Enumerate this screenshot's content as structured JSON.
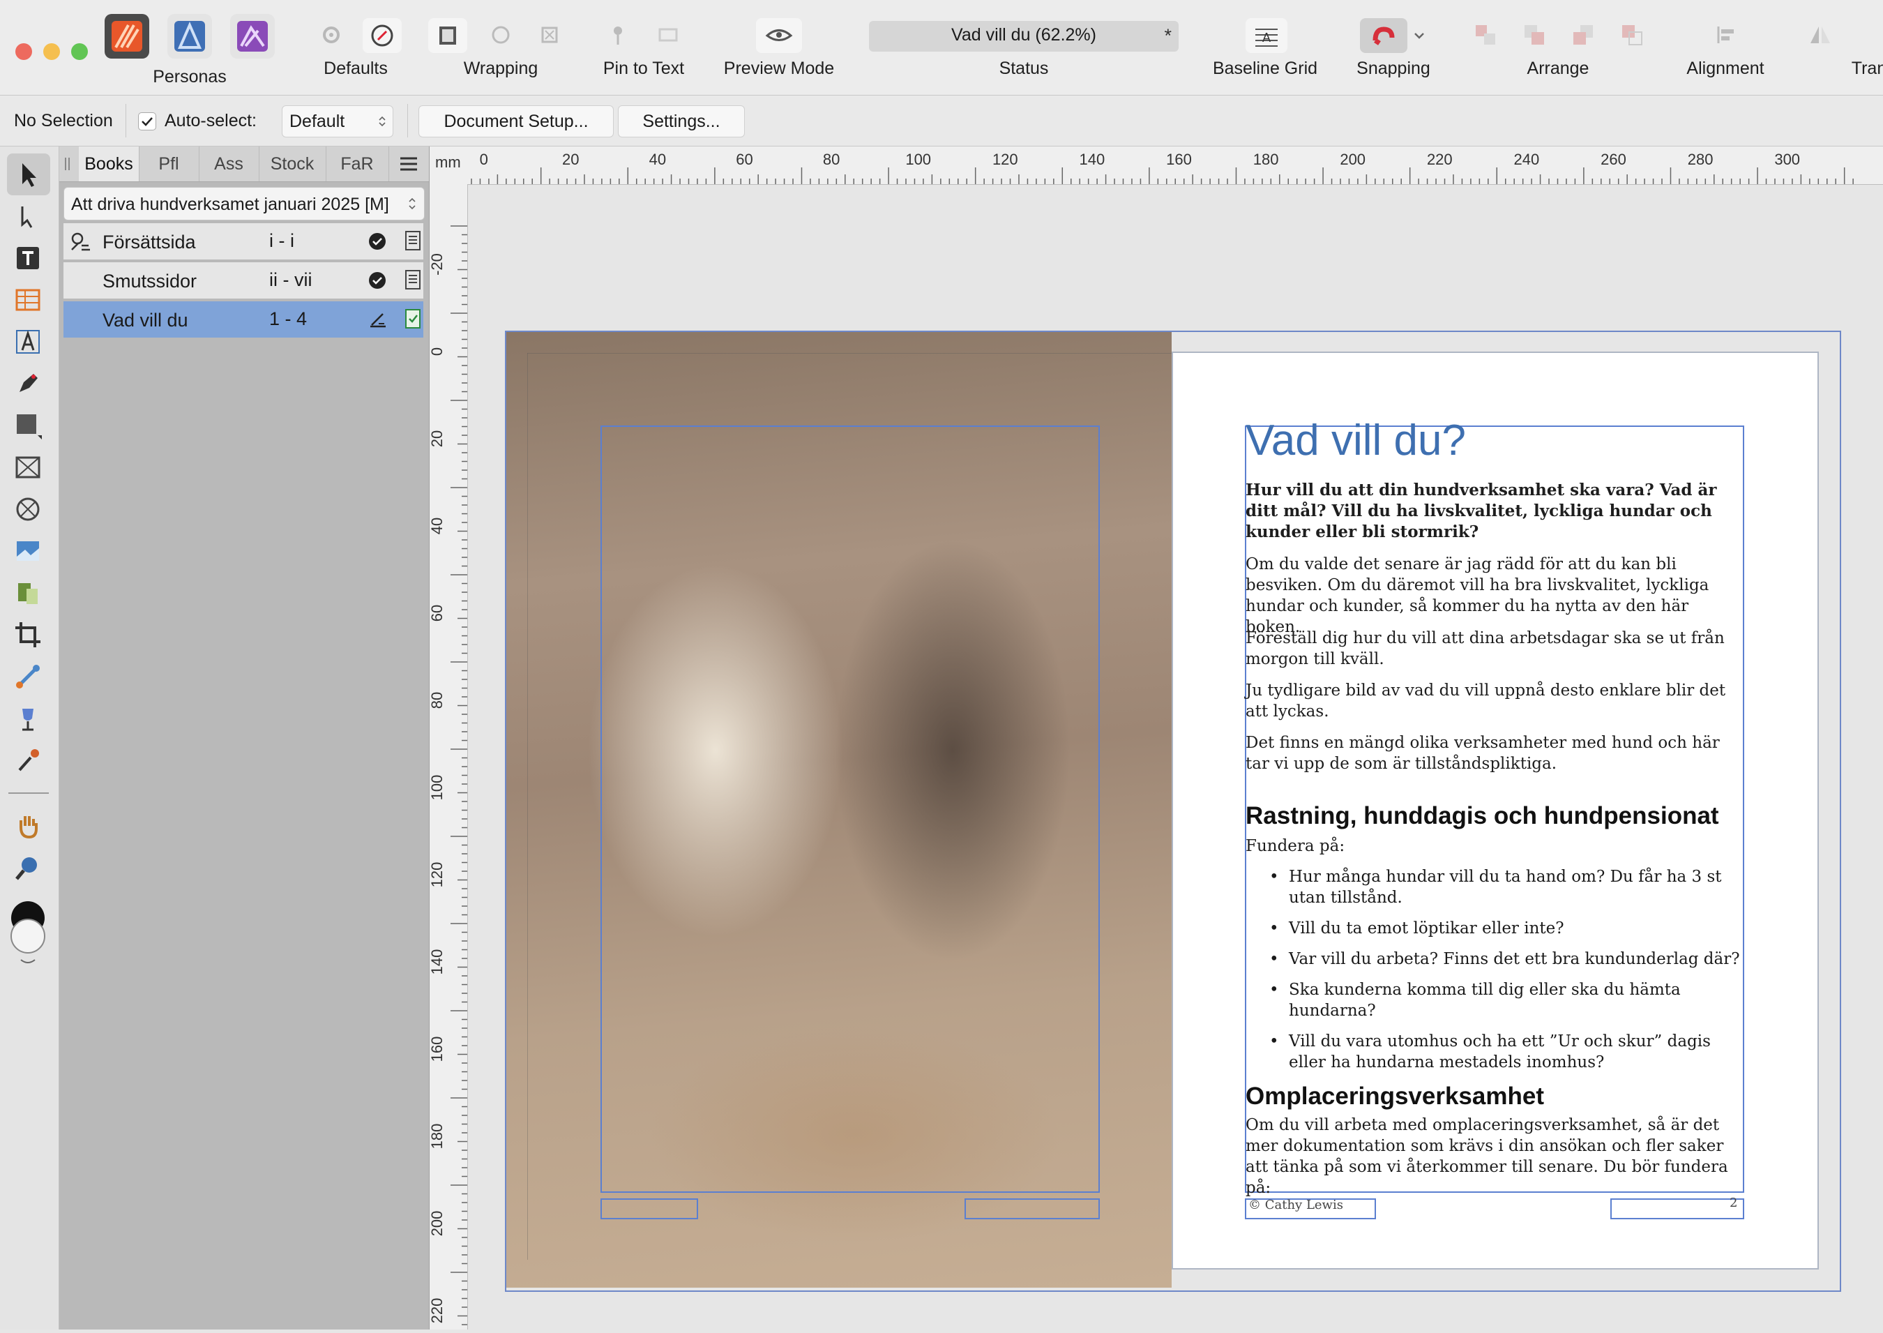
{
  "toolbar": {
    "personas_label": "Personas",
    "defaults_label": "Defaults",
    "wrapping_label": "Wrapping",
    "pin_to_text_label": "Pin to Text",
    "preview_mode_label": "Preview Mode",
    "status_value": "Vad vill du (62.2%)",
    "status_modified": "*",
    "status_label": "Status",
    "baseline_grid_label": "Baseline Grid",
    "snapping_label": "Snapping",
    "arrange_label": "Arrange",
    "alignment_label": "Alignment",
    "transform_label": "Tran"
  },
  "context": {
    "selection": "No Selection",
    "auto_select_label": "Auto-select:",
    "auto_select_value": "Default",
    "document_setup": "Document Setup...",
    "settings": "Settings..."
  },
  "panel": {
    "tabs": [
      "Books",
      "Pfl",
      "Ass",
      "Stock",
      "FaR"
    ],
    "book_name": "Att driva hundverksamet januari 2025 [M]",
    "chapters": [
      {
        "name": "Försättsida",
        "pages": "i - i",
        "selected": false
      },
      {
        "name": "Smutssidor",
        "pages": "ii - vii",
        "selected": false
      },
      {
        "name": "Vad vill du",
        "pages": "1 - 4",
        "selected": true
      }
    ]
  },
  "rulers": {
    "unit": "mm",
    "h_ticks": [
      "0",
      "20",
      "40",
      "60",
      "80",
      "100",
      "120",
      "140",
      "160",
      "180",
      "200",
      "220",
      "240",
      "260",
      "280",
      "300"
    ],
    "v_ticks": [
      "-20",
      "0",
      "20",
      "40",
      "60",
      "80",
      "100",
      "120",
      "140",
      "160",
      "180",
      "200",
      "220"
    ]
  },
  "page": {
    "heading": "Vad vill du?",
    "lead": "Hur vill du att din hundverksamhet ska vara? Vad är ditt mål? Vill du ha livskvalitet, lyckliga hundar och kunder eller bli stormrik?",
    "paragraphs": [
      "Om du valde det senare är jag rädd för att du kan bli besviken. Om du däremot vill ha bra livskvalitet, lyckliga hundar och kunder, så kommer du ha nytta av den här boken.",
      "Föreställ dig hur du vill att dina arbetsdagar ska se ut från morgon till kväll.",
      "Ju tydligare bild av vad du vill uppnå desto enklare blir det att lyckas.",
      "Det finns en mängd olika verksamheter med hund och här tar vi upp de som är tillståndspliktiga."
    ],
    "section1_title": "Rastning, hunddagis och hundpensionat",
    "section1_intro": "Fundera på:",
    "bullets": [
      "Hur många hundar vill du ta hand om? Du får ha 3 st utan tillstånd.",
      "Vill du ta emot löptikar eller inte?",
      "Var vill du arbeta? Finns det ett bra kundunderlag där?",
      "Ska kunderna komma till dig eller ska du hämta hundarna?",
      "Vill du vara utomhus och ha ett ”Ur och skur” dagis eller ha hundarna mestadels inomhus?"
    ],
    "section2_title": "Omplaceringsverksamhet",
    "section2_text": "Om du vill arbeta med omplaceringsverksamhet, så är det mer dokumentation som krävs i din ansökan och fler saker att tänka på som vi återkommer till senare. Du bör fundera på:",
    "footer_credit": "© Cathy Lewis",
    "page_number": "2"
  },
  "colors": {
    "accent": "#3e6fb0",
    "frame_outline": "#5b7fd0",
    "selection_row": "#7fa3d8"
  }
}
